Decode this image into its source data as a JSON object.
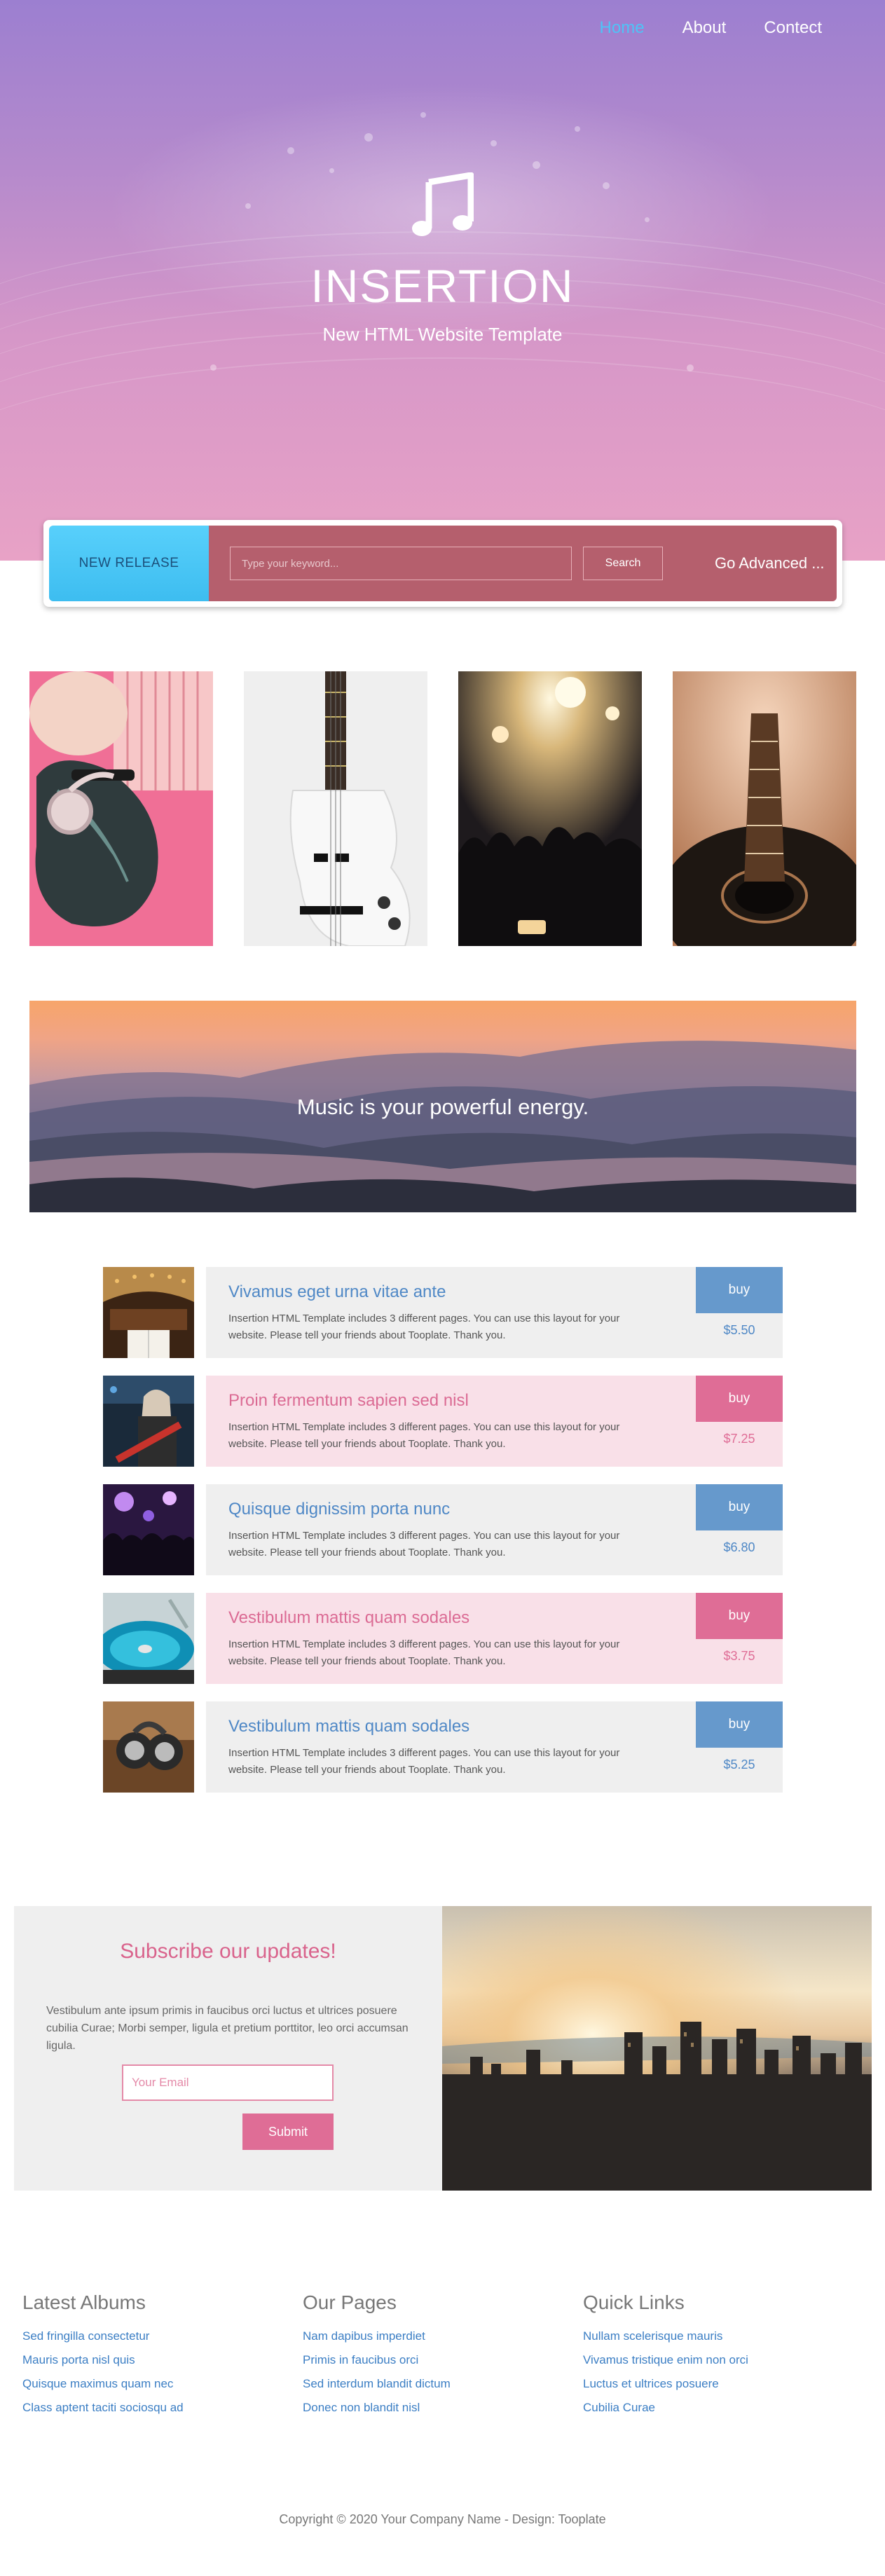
{
  "nav": {
    "items": [
      "Home",
      "About",
      "Contect"
    ]
  },
  "hero": {
    "title": "INSERTION",
    "subtitle": "New HTML Website Template"
  },
  "search": {
    "new_release_label": "NEW RELEASE",
    "placeholder": "Type your keyword...",
    "search_label": "Search",
    "advanced_label": "Go Advanced ..."
  },
  "banner": {
    "text": "Music is your powerful energy."
  },
  "products": [
    {
      "title": "Vivamus eget urna vitae ante",
      "description": "Insertion HTML Template includes 3 different pages. You can use this layout for your website. Please tell your friends about Tooplate. Thank you.",
      "buy_label": "buy",
      "price": "$5.50"
    },
    {
      "title": "Proin fermentum sapien sed nisl",
      "description": "Insertion HTML Template includes 3 different pages. You can use this layout for your website. Please tell your friends about Tooplate. Thank you.",
      "buy_label": "buy",
      "price": "$7.25"
    },
    {
      "title": "Quisque dignissim porta nunc",
      "description": "Insertion HTML Template includes 3 different pages. You can use this layout for your website. Please tell your friends about Tooplate. Thank you.",
      "buy_label": "buy",
      "price": "$6.80"
    },
    {
      "title": "Vestibulum mattis quam sodales",
      "description": "Insertion HTML Template includes 3 different pages. You can use this layout for your website. Please tell your friends about Tooplate. Thank you.",
      "buy_label": "buy",
      "price": "$3.75"
    },
    {
      "title": "Vestibulum mattis quam sodales",
      "description": "Insertion HTML Template includes 3 different pages. You can use this layout for your website. Please tell your friends about Tooplate. Thank you.",
      "buy_label": "buy",
      "price": "$5.25"
    }
  ],
  "subscribe": {
    "title": "Subscribe our updates!",
    "text": "Vestibulum ante ipsum primis in faucibus orci luctus et ultrices posuere cubilia Curae; Morbi semper, ligula et pretium porttitor, leo orci accumsan ligula.",
    "email_placeholder": "Your Email",
    "submit_label": "Submit"
  },
  "footer": {
    "columns": [
      {
        "title": "Latest Albums",
        "links": [
          "Sed fringilla consectetur",
          "Mauris porta nisl quis",
          "Quisque maximus quam nec",
          "Class aptent taciti sociosqu ad"
        ]
      },
      {
        "title": "Our Pages",
        "links": [
          "Nam dapibus imperdiet",
          "Primis in faucibus orci",
          "Sed interdum blandit dictum",
          "Donec non blandit nisl"
        ]
      },
      {
        "title": "Quick Links",
        "links": [
          "Nullam scelerisque mauris",
          "Vivamus tristique enim non orci",
          "Luctus et ultrices posuere",
          "Cubilia Curae"
        ]
      }
    ],
    "copyright": "Copyright © 2020 Your Company Name - Design: Tooplate"
  }
}
